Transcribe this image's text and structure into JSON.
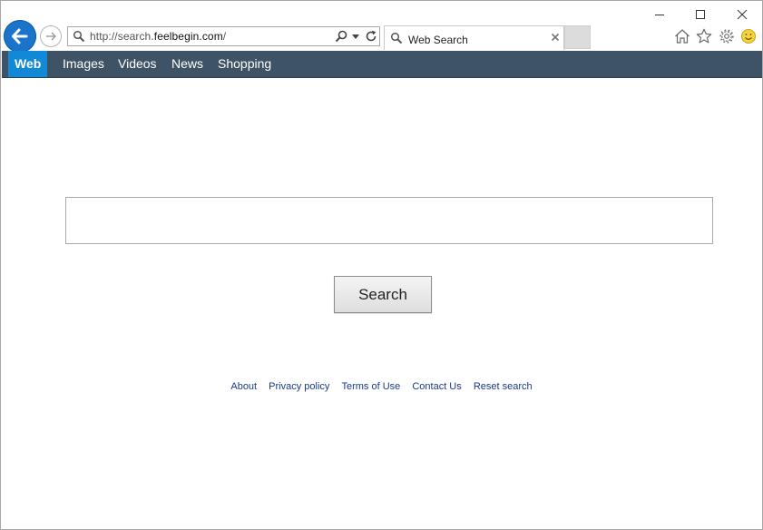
{
  "browser": {
    "address": {
      "url_prefix": "http://search.",
      "url_host": "feelbegin.com",
      "url_suffix": "/"
    },
    "tab": {
      "title": "Web Search",
      "close_glyph": "×"
    },
    "icons": {
      "back": "back-arrow-icon",
      "forward": "forward-arrow-icon",
      "home": "home-icon",
      "favorites": "star-icon",
      "tools": "gear-icon",
      "feedback": "smiley-icon"
    },
    "accent_color": "#1289d8",
    "nav_bar_color": "#3f5366"
  },
  "site_nav": {
    "items": [
      {
        "label": "Web",
        "active": true
      },
      {
        "label": "Images",
        "active": false
      },
      {
        "label": "Videos",
        "active": false
      },
      {
        "label": "News",
        "active": false
      },
      {
        "label": "Shopping",
        "active": false
      }
    ]
  },
  "search": {
    "value": "",
    "button_label": "Search"
  },
  "footer": {
    "links": [
      "About",
      "Privacy policy",
      "Terms of Use",
      "Contact Us",
      "Reset search"
    ]
  }
}
